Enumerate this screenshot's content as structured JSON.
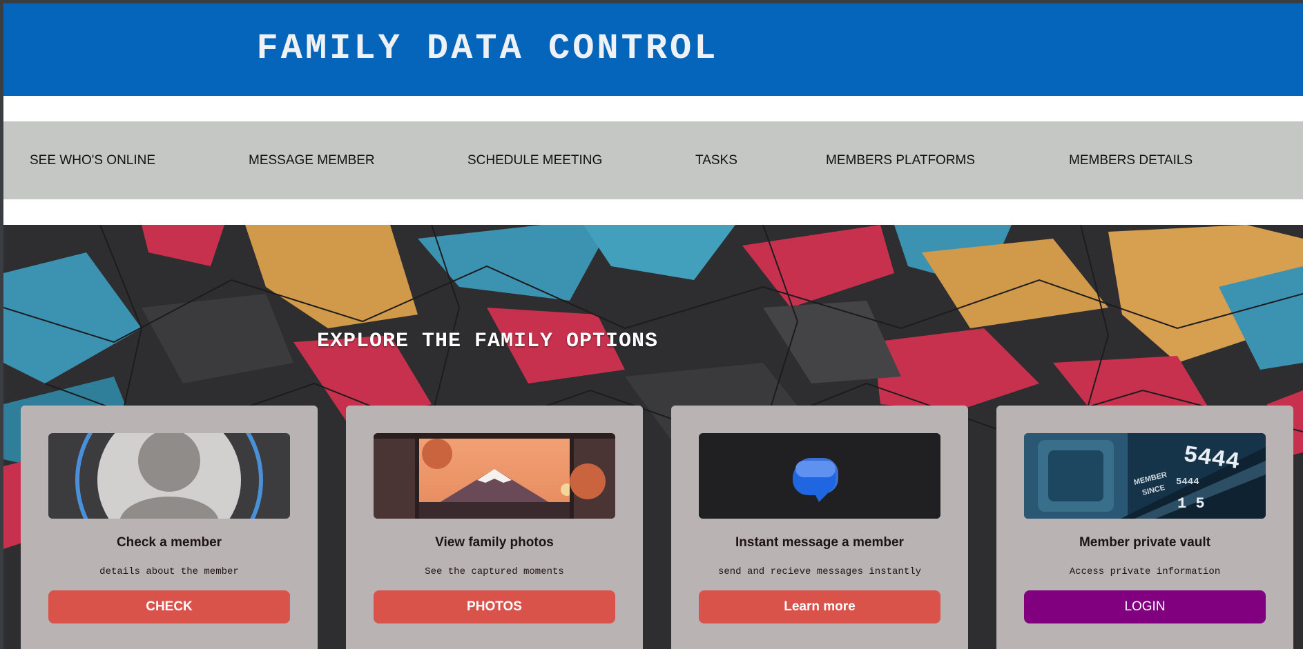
{
  "header": {
    "title": "FAMILY DATA CONTROL"
  },
  "nav": {
    "items": [
      {
        "label": "SEE WHO'S ONLINE"
      },
      {
        "label": "MESSAGE MEMBER"
      },
      {
        "label": "SCHEDULE MEETING"
      },
      {
        "label": "TASKS"
      },
      {
        "label": "MEMBERS PLATFORMS"
      },
      {
        "label": "MEMBERS DETAILS"
      }
    ]
  },
  "hero": {
    "title": "EXPLORE THE FAMILY OPTIONS"
  },
  "cards": [
    {
      "title": "Check a member",
      "description": "details about the member",
      "button": "CHECK",
      "icon": "avatar-icon"
    },
    {
      "title": "View family photos",
      "description": "See the captured moments",
      "button": "PHOTOS",
      "icon": "mountain-sunset-photo"
    },
    {
      "title": "Instant message a member",
      "description": "send and recieve messages instantly",
      "button": "Learn more",
      "icon": "chat-bubble-icon"
    },
    {
      "title": "Member private vault",
      "description": "Access private information",
      "button": "LOGIN",
      "icon": "credit-card-photo"
    }
  ],
  "colors": {
    "header_bg": "#0465bb",
    "nav_bg": "#c4c7c3",
    "card_bg": "#b9b4b3",
    "button_red": "#d9534b",
    "button_purple": "#800080"
  }
}
